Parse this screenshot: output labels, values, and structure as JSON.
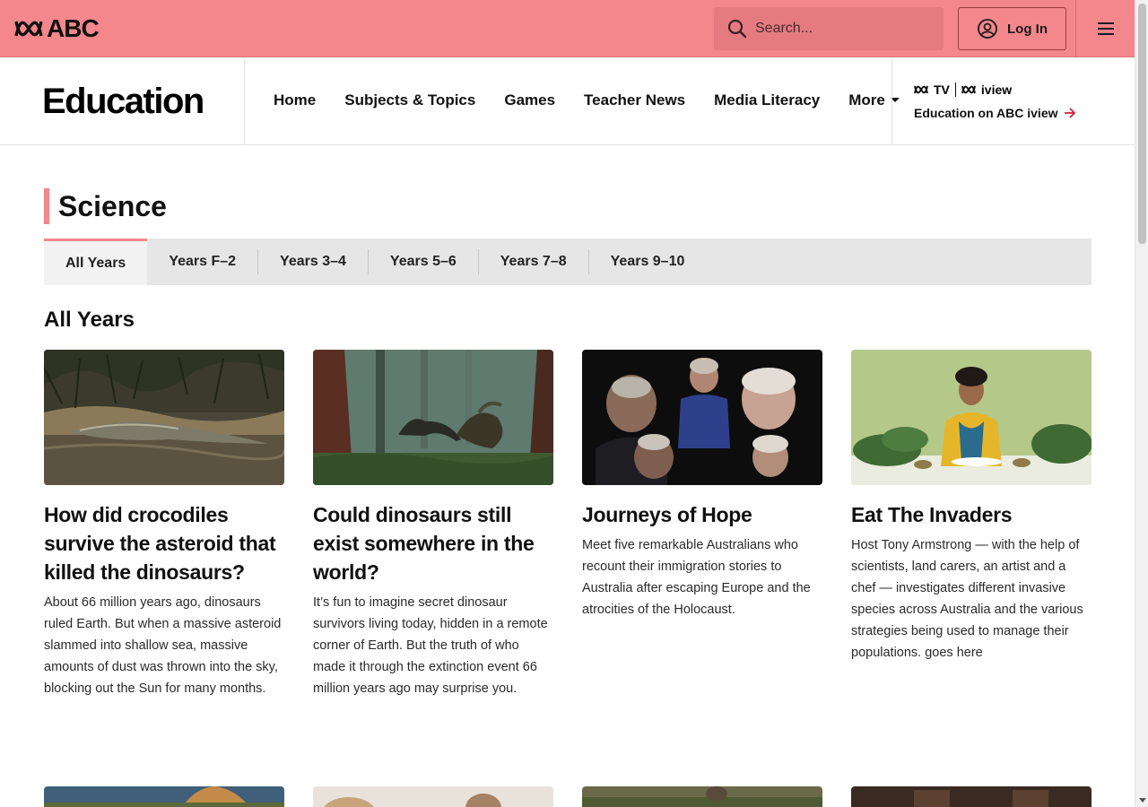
{
  "header": {
    "logo_text": "ABC",
    "search_placeholder": "Search...",
    "login_label": "Log In"
  },
  "edu": {
    "title": "Education",
    "nav": [
      "Home",
      "Subjects & Topics",
      "Games",
      "Teacher News",
      "Media Literacy",
      "More"
    ],
    "iview_logo_tv": "TV",
    "iview_logo_iview": "iview",
    "iview_link": "Education on ABC iview"
  },
  "page": {
    "heading": "Science",
    "tabs": [
      "All Years",
      "Years F–2",
      "Years 3–4",
      "Years 5–6",
      "Years 7–8",
      "Years 9–10"
    ],
    "active_tab": "All Years",
    "section_title": "All Years"
  },
  "cards": [
    {
      "title": "How did crocodiles survive the asteroid that killed the dinosaurs?",
      "desc": "About 66 million years ago, dinosaurs ruled Earth. But when a massive asteroid slammed into shallow sea, massive amounts of dust was thrown into the sky, blocking out the Sun for many months."
    },
    {
      "title": "Could dinosaurs still exist somewhere in the world?",
      "desc": "It’s fun to imagine secret dinosaur survivors living today, hidden in a remote corner of Earth. But the truth of who made it through the extinction event 66 million years ago may surprise you."
    },
    {
      "title": "Journeys of Hope",
      "desc": "Meet five remarkable Australians who recount their immigration stories to Australia after escaping Europe and the atrocities of the Holocaust."
    },
    {
      "title": "Eat The Invaders",
      "desc": "Host Tony Armstrong — with the help of scientists, land carers, an artist and a chef — investigates different invasive species across Australia and the various strategies being used to manage their populations. goes here"
    }
  ],
  "colors": {
    "brand": "#f3878b",
    "link_arrow": "#d0263a"
  }
}
